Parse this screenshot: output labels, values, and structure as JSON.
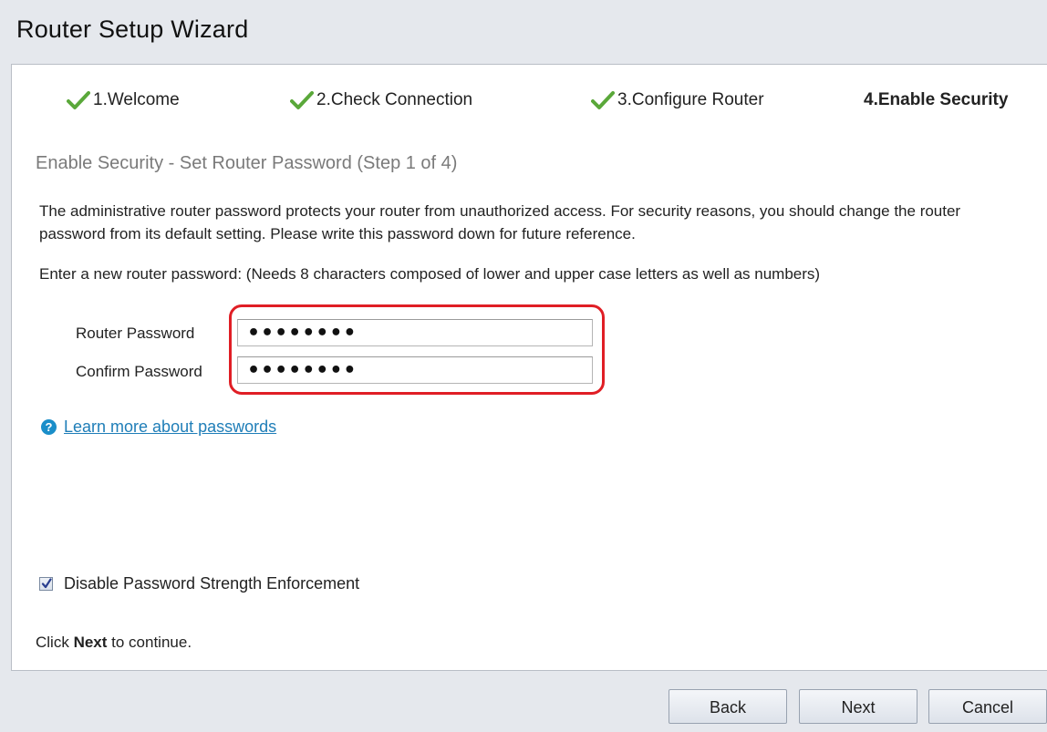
{
  "window": {
    "title": "Router Setup Wizard"
  },
  "steps": [
    {
      "label": "1.Welcome",
      "completed": true
    },
    {
      "label": "2.Check Connection",
      "completed": true
    },
    {
      "label": "3.Configure Router",
      "completed": true
    },
    {
      "label": "4.Enable Security",
      "completed": false,
      "active": true
    }
  ],
  "main": {
    "subtitle": "Enable Security - Set Router Password (Step 1 of 4)",
    "description": "The administrative router password protects your router from unauthorized access. For security reasons, you should change the router password from its default setting. Please write this password down for future reference.",
    "instruction": "Enter a new router password: (Needs 8 characters composed of lower and upper case letters as well as numbers)",
    "router_password": {
      "label": "Router Password",
      "value": "********"
    },
    "confirm_password": {
      "label": "Confirm Password",
      "value": "********"
    },
    "help_link": "Learn more about passwords",
    "disable_enforcement": {
      "label": "Disable Password Strength Enforcement",
      "checked": true
    },
    "continue_prefix": "Click ",
    "continue_bold": "Next",
    "continue_suffix": " to continue."
  },
  "buttons": {
    "back": "Back",
    "next": "Next",
    "cancel": "Cancel"
  },
  "colors": {
    "check_green": "#5aa83a",
    "highlight_red": "#e01e25",
    "link_blue": "#1f7eb8"
  }
}
